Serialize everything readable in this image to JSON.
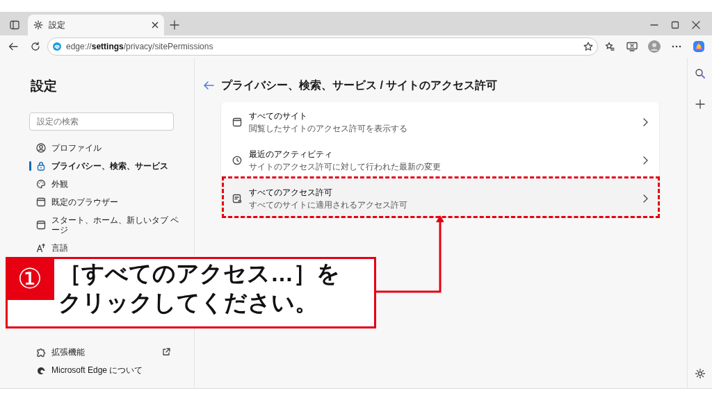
{
  "browser": {
    "tab": {
      "title": "設定",
      "selected": true
    },
    "address": {
      "scheme": "edge://",
      "host": "settings",
      "path": "/privacy/sitePermissions"
    }
  },
  "sidebar": {
    "title": "設定",
    "search": {
      "placeholder": "設定の検索"
    },
    "items": [
      {
        "label": "プロファイル",
        "selected": false
      },
      {
        "label": "プライバシー、検索、サービス",
        "selected": true
      },
      {
        "label": "外観",
        "selected": false
      },
      {
        "label": "既定のブラウザー",
        "selected": false
      },
      {
        "label": "スタート、ホーム、新しいタブ ページ",
        "selected": false
      },
      {
        "label": "言語",
        "selected": false
      }
    ],
    "footer_items": [
      {
        "label": "拡張機能"
      },
      {
        "label": "Microsoft Edge について"
      }
    ]
  },
  "page": {
    "breadcrumb": "プライバシー、検索、サービス / サイトのアクセス許可",
    "rows": [
      {
        "title": "すべてのサイト",
        "subtitle": "閲覧したサイトのアクセス許可を表示する",
        "highlighted": false
      },
      {
        "title": "最近のアクティビティ",
        "subtitle": "サイトのアクセス許可に対して行われた最新の変更",
        "highlighted": false
      },
      {
        "title": "すべてのアクセス許可",
        "subtitle": "すべてのサイトに適用されるアクセス許可",
        "highlighted": true
      }
    ]
  },
  "callout": {
    "number": "①",
    "lines": [
      "［すべてのアクセス…］を",
      "クリックしてください。"
    ]
  }
}
